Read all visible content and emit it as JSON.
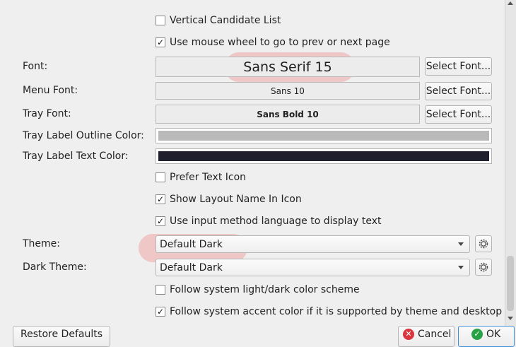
{
  "checkboxes": {
    "vertical_candidate_list": {
      "label": "Vertical Candidate List",
      "checked": false
    },
    "mouse_wheel": {
      "label": "Use mouse wheel to go to prev or next page",
      "checked": true
    },
    "prefer_text_icon": {
      "label": "Prefer Text Icon",
      "checked": false
    },
    "show_layout_name": {
      "label": "Show Layout Name In Icon",
      "checked": true
    },
    "input_method_language": {
      "label": "Use input method language to display text",
      "checked": true
    },
    "follow_light_dark": {
      "label": "Follow system light/dark color scheme",
      "checked": false
    },
    "follow_accent": {
      "label": "Follow system accent color if it is supported by theme and desktop",
      "checked": true
    }
  },
  "fonts": {
    "font": {
      "label": "Font:",
      "value": "Sans Serif 15",
      "button": "Select Font..."
    },
    "menu_font": {
      "label": "Menu Font:",
      "value": "Sans 10",
      "button": "Select Font..."
    },
    "tray_font": {
      "label": "Tray Font:",
      "value": "Sans Bold 10",
      "button": "Select Font..."
    }
  },
  "colors": {
    "outline": {
      "label": "Tray Label Outline Color:",
      "value": "#b9b9b9"
    },
    "text": {
      "label": "Tray Label Text Color:",
      "value": "#1f1f2e"
    }
  },
  "themes": {
    "theme": {
      "label": "Theme:",
      "value": "Default Dark"
    },
    "dark_theme": {
      "label": "Dark Theme:",
      "value": "Default Dark"
    }
  },
  "buttons": {
    "restore": "Restore Defaults",
    "cancel": "Cancel",
    "ok": "OK"
  },
  "highlight_color": "#f09696"
}
